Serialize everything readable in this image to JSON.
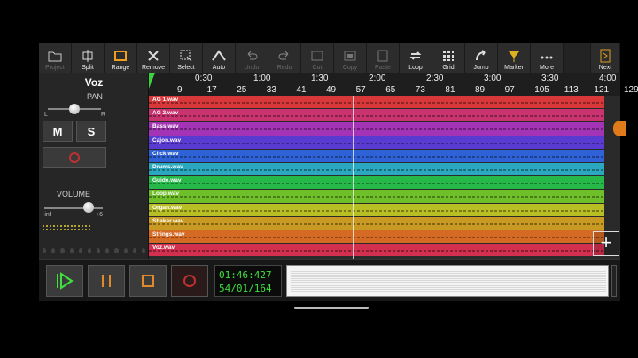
{
  "toolbar": {
    "buttons": [
      {
        "label": "Project",
        "icon": "folder-icon",
        "dim": true
      },
      {
        "label": "Split",
        "icon": "split-icon",
        "dim": false
      },
      {
        "label": "Range",
        "icon": "range-icon",
        "dim": false
      },
      {
        "label": "Remove",
        "icon": "remove-icon",
        "dim": false
      },
      {
        "label": "Select",
        "icon": "select-icon",
        "dim": false
      },
      {
        "label": "Auto",
        "icon": "automation-icon",
        "dim": false
      },
      {
        "label": "Undo",
        "icon": "undo-icon",
        "dim": true
      },
      {
        "label": "Redo",
        "icon": "redo-icon",
        "dim": true
      },
      {
        "label": "Cut",
        "icon": "cut-icon",
        "dim": true
      },
      {
        "label": "Copy",
        "icon": "copy-icon",
        "dim": true
      },
      {
        "label": "Paste",
        "icon": "paste-icon",
        "dim": true
      },
      {
        "label": "Loop",
        "icon": "loop-icon",
        "dim": false
      },
      {
        "label": "Grid",
        "icon": "grid-icon",
        "dim": false
      },
      {
        "label": "Jump",
        "icon": "jump-icon",
        "dim": false
      },
      {
        "label": "Marker",
        "icon": "marker-icon",
        "dim": false
      },
      {
        "label": "More",
        "icon": "more-icon",
        "dim": false
      }
    ],
    "next_label": "Next"
  },
  "left_panel": {
    "track_name": "Voz",
    "pan_label": "PAN",
    "pan_left": "L",
    "pan_right": "R",
    "mute_label": "M",
    "solo_label": "S",
    "volume_label": "VOLUME",
    "vol_min": "-inf",
    "vol_max": "+6",
    "pan_value": 0.5,
    "volume_value": 0.75
  },
  "ruler": {
    "times": [
      "0:30",
      "1:00",
      "1:30",
      "2:00",
      "2:30",
      "3:00",
      "3:30",
      "4:00"
    ],
    "bars": [
      "9",
      "17",
      "25",
      "33",
      "41",
      "49",
      "57",
      "65",
      "73",
      "81",
      "89",
      "97",
      "105",
      "113",
      "121",
      "129"
    ]
  },
  "tracks": [
    {
      "name": "AG 1.wav",
      "color": "#d9383b"
    },
    {
      "name": "AG 2.wav",
      "color": "#c93470"
    },
    {
      "name": "Bass.wav",
      "color": "#a234b5"
    },
    {
      "name": "Cajon.wav",
      "color": "#5a3bd1"
    },
    {
      "name": "Click.wav",
      "color": "#2f62d6"
    },
    {
      "name": "Drums.wav",
      "color": "#2aa8bf"
    },
    {
      "name": "Guide.wav",
      "color": "#27b84a"
    },
    {
      "name": "Loop.wav",
      "color": "#6fbf2a"
    },
    {
      "name": "Organ.wav",
      "color": "#b7bf24"
    },
    {
      "name": "Shaker.wav",
      "color": "#c99a23"
    },
    {
      "name": "Strings.wav",
      "color": "#d46a24"
    },
    {
      "name": "Voz.wav",
      "color": "#d3304f"
    }
  ],
  "transport": {
    "time": "01:46:427",
    "position": "54/01/164"
  },
  "colors": {
    "timecode": "#3ee23e",
    "record": "#c03030",
    "accent_orange": "#e07a1a"
  }
}
